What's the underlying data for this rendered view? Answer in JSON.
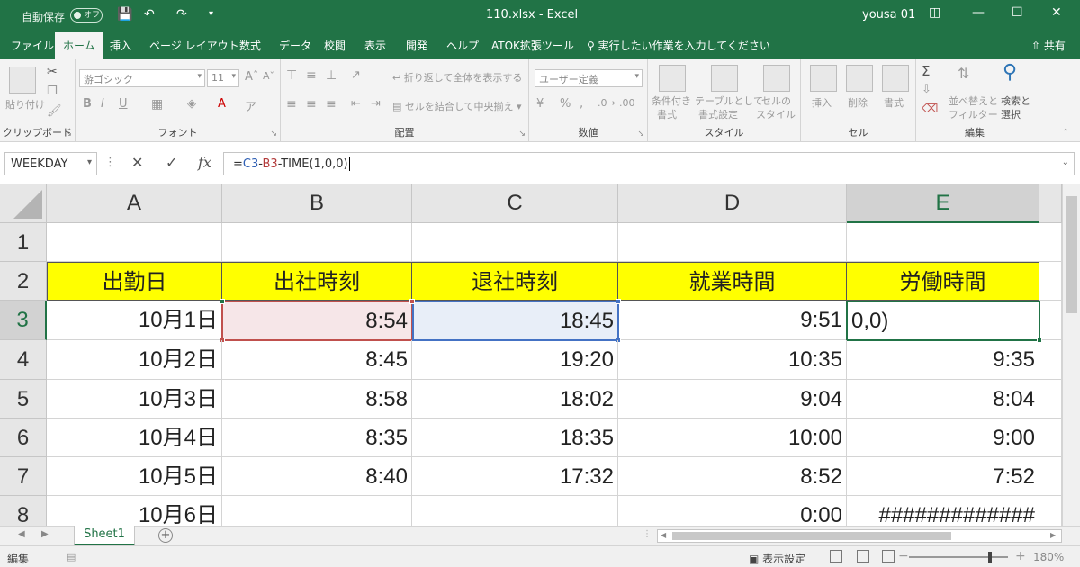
{
  "titlebar": {
    "autosave_label": "自動保存",
    "autosave_state": "オフ",
    "document_title": "110.xlsx  -  Excel",
    "user": "yousa 01"
  },
  "ribbon_tabs": [
    "ファイル",
    "ホーム",
    "挿入",
    "ページ レイアウト",
    "数式",
    "データ",
    "校閲",
    "表示",
    "開発",
    "ヘルプ",
    "ATOK拡張ツール"
  ],
  "active_tab": "ホーム",
  "tell_me": "実行したい作業を入力してください",
  "share_label": "共有",
  "ribbon": {
    "clipboard": {
      "label": "クリップボード",
      "paste": "貼り付け"
    },
    "font": {
      "label": "フォント",
      "font_name": "游ゴシック",
      "font_size": "11"
    },
    "alignment": {
      "label": "配置",
      "wrap": "折り返して全体を表示する",
      "merge": "セルを結合して中央揃え"
    },
    "number": {
      "label": "数値",
      "format": "ユーザー定義"
    },
    "styles": {
      "label": "スタイル",
      "conditional_l1": "条件付き",
      "conditional_l2": "書式",
      "table_l1": "テーブルとして",
      "table_l2": "書式設定",
      "cell_l1": "セルの",
      "cell_l2": "スタイル"
    },
    "cells": {
      "label": "セル",
      "insert": "挿入",
      "delete": "削除",
      "format": "書式"
    },
    "editing": {
      "label": "編集",
      "sort_l1": "並べ替えと",
      "sort_l2": "フィルター",
      "find_l1": "検索と",
      "find_l2": "選択"
    }
  },
  "formula_bar": {
    "name_box": "WEEKDAY",
    "formula_prefix": "=",
    "ref_c3": "C3",
    "minus1": "-",
    "ref_b3": "B3",
    "formula_rest": "-TIME(1,0,0)"
  },
  "columns": [
    "A",
    "B",
    "C",
    "D",
    "E"
  ],
  "rows": [
    "1",
    "2",
    "3",
    "4",
    "5",
    "6",
    "7",
    "8"
  ],
  "headers": [
    "出勤日",
    "出社時刻",
    "退社時刻",
    "就業時間",
    "労働時間"
  ],
  "data_rows": [
    [
      "10月1日",
      "8:54",
      "18:45",
      "9:51",
      "0,0)"
    ],
    [
      "10月2日",
      "8:45",
      "19:20",
      "10:35",
      "9:35"
    ],
    [
      "10月3日",
      "8:58",
      "18:02",
      "9:04",
      "8:04"
    ],
    [
      "10月4日",
      "8:35",
      "18:35",
      "10:00",
      "9:00"
    ],
    [
      "10月5日",
      "8:40",
      "17:32",
      "8:52",
      "7:52"
    ],
    [
      "10月6日",
      "",
      "",
      "0:00",
      "#############"
    ]
  ],
  "sheet_tab": "Sheet1",
  "status": {
    "mode": "編集",
    "display_settings": "表示設定",
    "zoom": "180%"
  },
  "colors": {
    "excel_green": "#217346",
    "header_fill": "#ffff00"
  }
}
